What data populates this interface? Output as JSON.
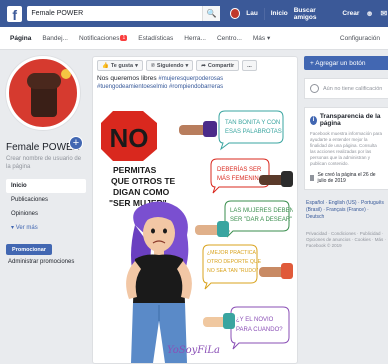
{
  "topbar": {
    "search_value": "Female POWER",
    "user_name": "Lau",
    "nav": [
      "Inicio",
      "Buscar amigos",
      "Crear"
    ]
  },
  "tabs": {
    "items": [
      "Página",
      "Bandej...",
      "Notificaciones",
      "Estadísticas",
      "Herra...",
      "Centro...",
      "Más"
    ],
    "notif_badge": "1",
    "config": "Configuración"
  },
  "left": {
    "page_name": "Female POWER",
    "username_prompt": "Crear nombre de usuario de la página",
    "nav": [
      "Inicio",
      "Publicaciones",
      "Opiniones"
    ],
    "more": "Ver más",
    "promote": "Promocionar",
    "admin_promos": "Administrar promociones"
  },
  "post": {
    "actions": [
      "Te gusta",
      "Siguiendo",
      "Compartir",
      "..."
    ],
    "text": "Nos queremos libres",
    "hashtags_line1": "#mujeresquerpoderosas",
    "hashtags_line2": "#tuengodeamientoeselmio #rompiendobarreras",
    "comic": {
      "no": "NO",
      "permitas": "PERMITAS QUE OTROS TE DIGAN COMO \"SER MUJER\"",
      "b1": "TAN BONITA Y CON ESAS PALABROTAS",
      "b2": "DEBERÍAS SER MÁS FEMENINA",
      "b3": "LAS MUJERES DEBEN SER \"DAR A DESEAR\"",
      "b4": "¿MEJOR PRACTICA OTRO DEPORTE QUE NO SEA TAN \"RUDO\"",
      "b5": "¿Y EL NOVIO PARA CUANDO?",
      "signature": "YoSoyFiLa"
    }
  },
  "right": {
    "add_button": "+ Agregar un botón",
    "rating": "Aún no tiene calificación",
    "transparency_title": "Transparencia de la página",
    "transparency_desc": "Facebook muestra información para ayudarte a entender mejor la finalidad de una página. Consulta las acciones realizadas por las personas que la administran y publican contenido.",
    "created": "Se creó la página el 26 de julio de 2019",
    "langs": "Español · English (US) · Português (Brasil) · Français (France) · Deutsch",
    "footer": "Privacidad · Condiciones · Publicidad · Opciones de anuncios · Cookies · Más · Facebook © 2019"
  },
  "colors": {
    "fb_blue": "#3b5998",
    "button_blue": "#4267b2",
    "profile_red": "#d63a2f",
    "comic_purple": "#8a4fb6"
  }
}
